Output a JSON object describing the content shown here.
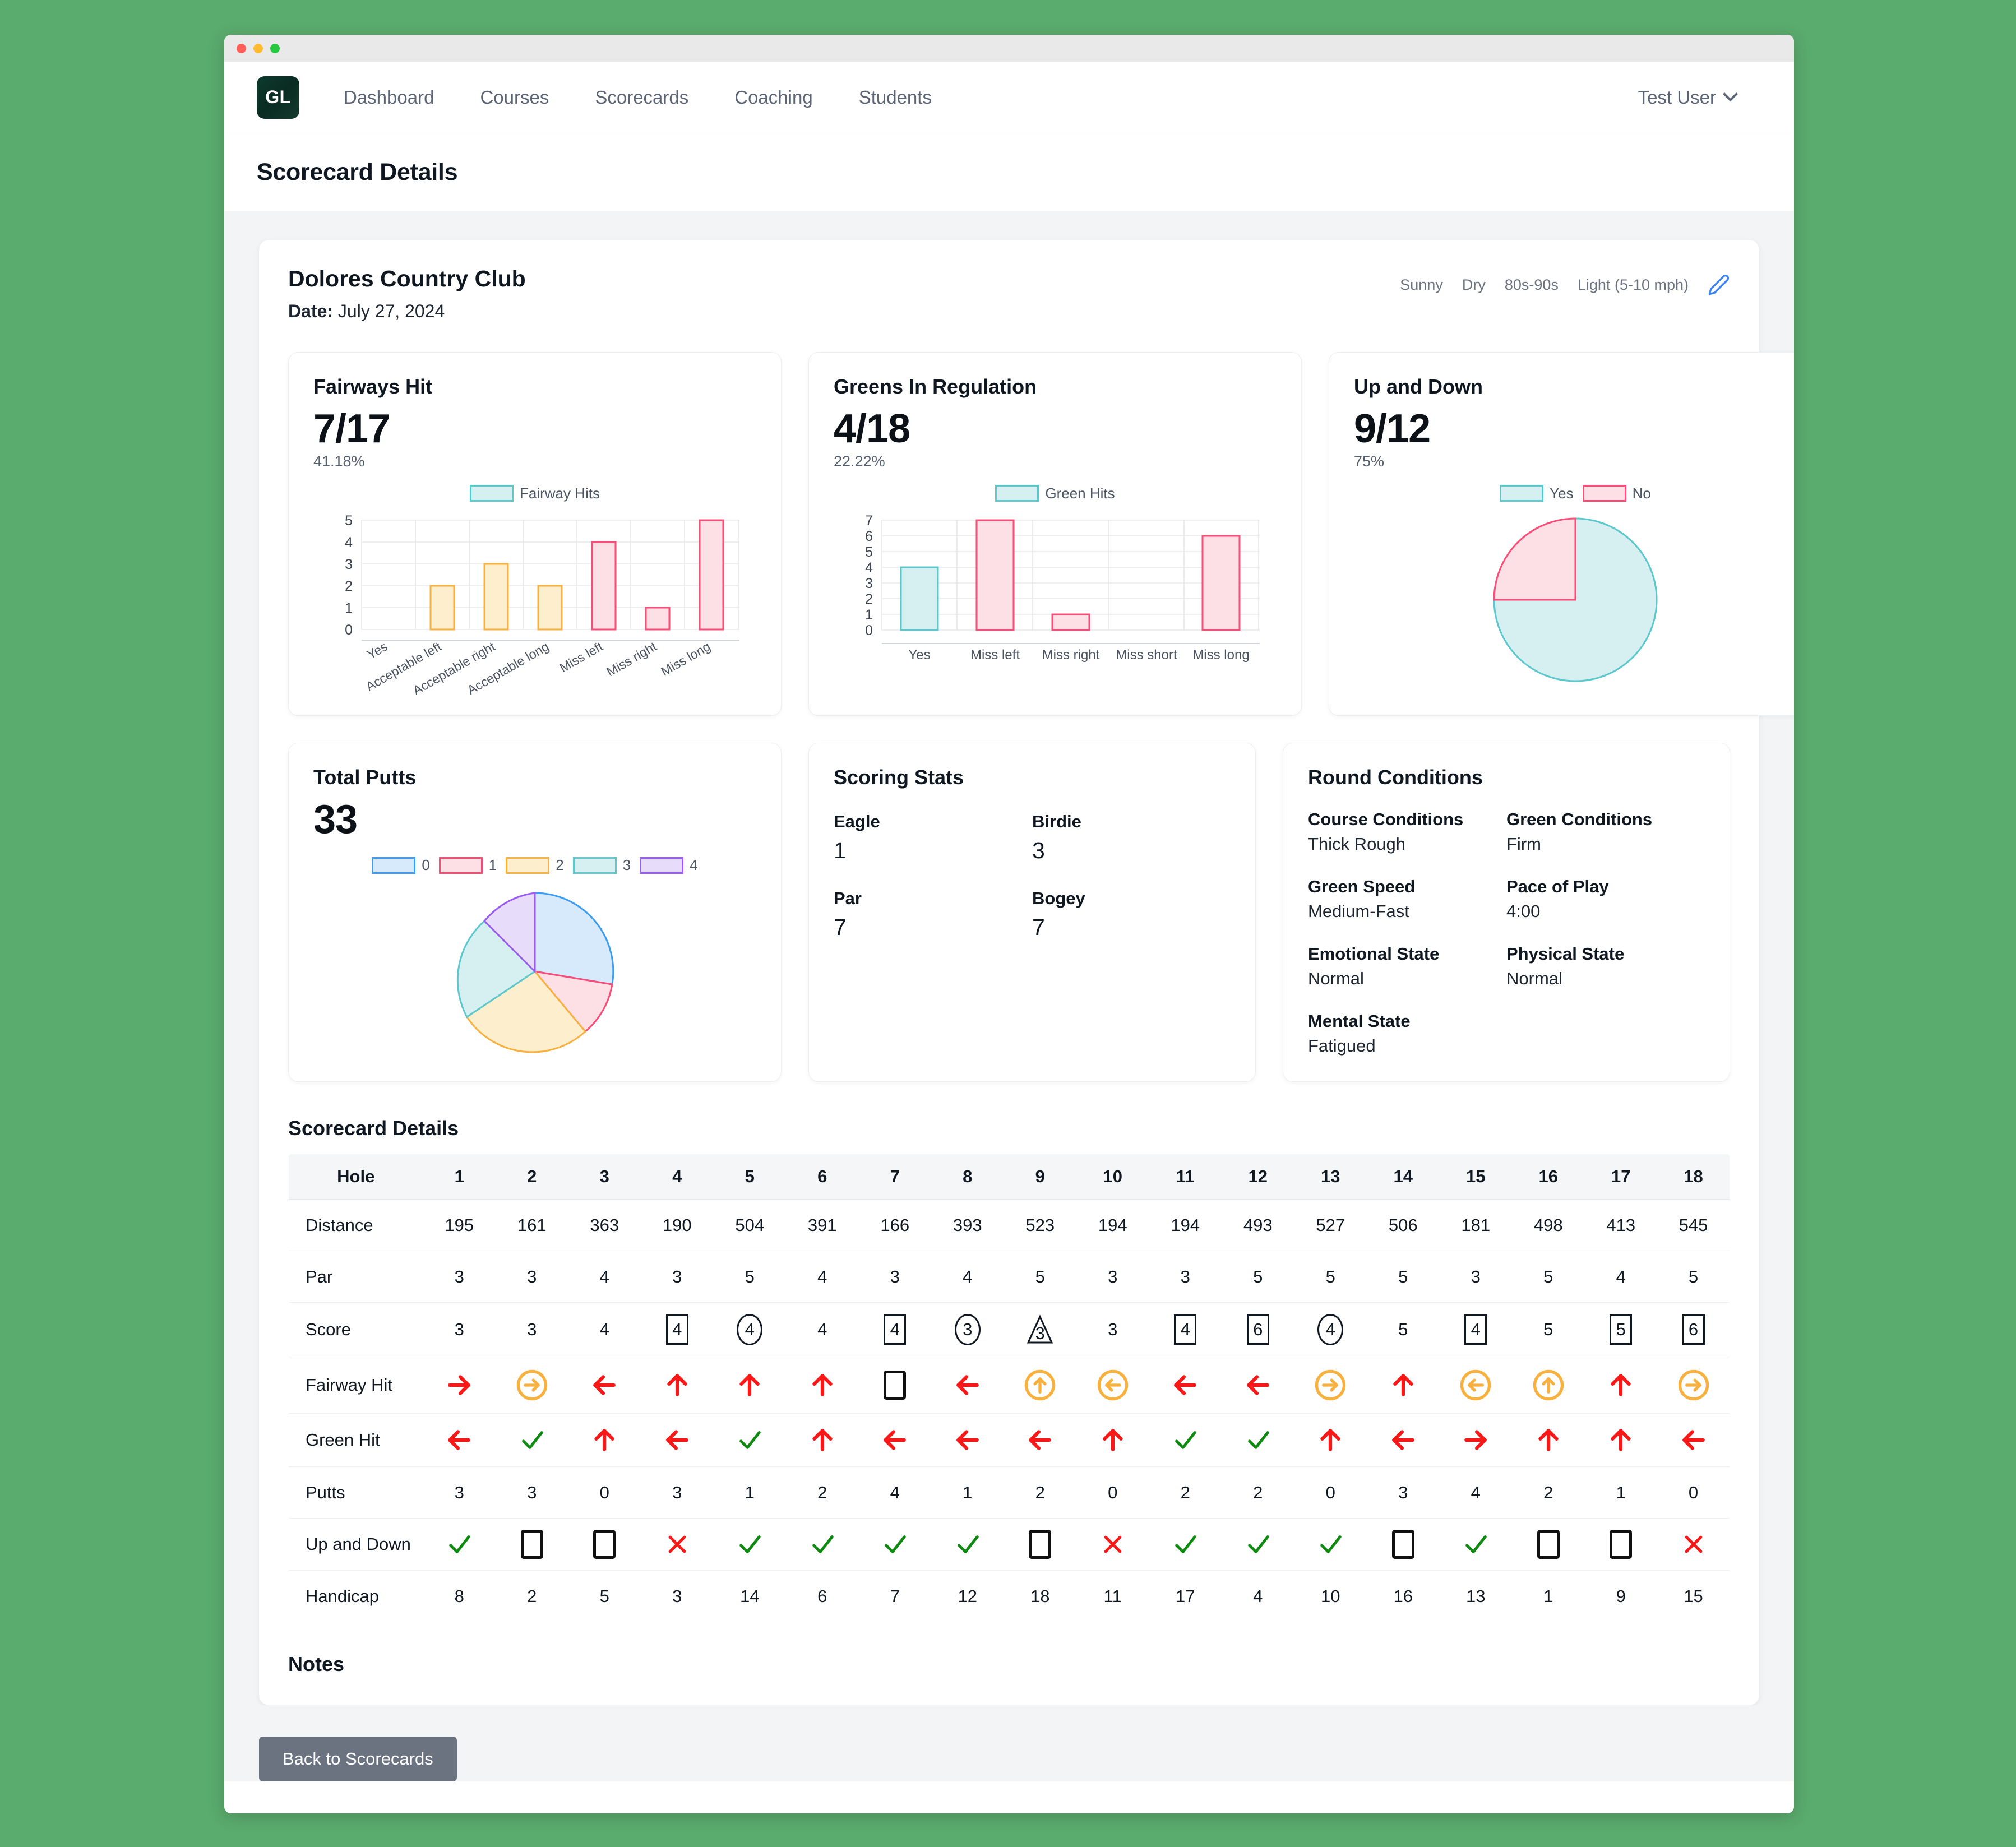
{
  "window": {
    "controls": [
      "close",
      "minimize",
      "maximize"
    ]
  },
  "nav": {
    "logo": "GL",
    "links": [
      "Dashboard",
      "Courses",
      "Scorecards",
      "Coaching",
      "Students"
    ],
    "user": "Test User"
  },
  "page": {
    "title": "Scorecard Details"
  },
  "course": {
    "name": "Dolores Country Club",
    "date_label": "Date:",
    "date_value": "July 27, 2024",
    "conditions_inline": [
      "Sunny",
      "Dry",
      "80s-90s",
      "Light (5-10 mph)"
    ],
    "edit_icon": "pencil-icon"
  },
  "cards": {
    "fairways": {
      "title": "Fairways Hit",
      "value": "7/17",
      "percent": "41.18%"
    },
    "gir": {
      "title": "Greens In Regulation",
      "value": "4/18",
      "percent": "22.22%"
    },
    "updown": {
      "title": "Up and Down",
      "value": "9/12",
      "percent": "75%"
    },
    "putts": {
      "title": "Total Putts",
      "value": "33"
    }
  },
  "scoring_stats": {
    "title": "Scoring Stats",
    "items": [
      {
        "label": "Eagle",
        "value": "1"
      },
      {
        "label": "Birdie",
        "value": "3"
      },
      {
        "label": "Par",
        "value": "7"
      },
      {
        "label": "Bogey",
        "value": "7"
      }
    ]
  },
  "round_conditions": {
    "title": "Round Conditions",
    "items": [
      {
        "label": "Course Conditions",
        "value": "Thick Rough"
      },
      {
        "label": "Green Conditions",
        "value": "Firm"
      },
      {
        "label": "Green Speed",
        "value": "Medium-Fast"
      },
      {
        "label": "Pace of Play",
        "value": "4:00"
      },
      {
        "label": "Emotional State",
        "value": "Normal"
      },
      {
        "label": "Physical State",
        "value": "Normal"
      },
      {
        "label": "Mental State",
        "value": "Fatigued"
      }
    ]
  },
  "scorecard": {
    "title": "Scorecard Details",
    "row_labels": [
      "Hole",
      "Distance",
      "Par",
      "Score",
      "Fairway Hit",
      "Green Hit",
      "Putts",
      "Up and Down",
      "Handicap"
    ],
    "holes": [
      1,
      2,
      3,
      4,
      5,
      6,
      7,
      8,
      9,
      10,
      11,
      12,
      13,
      14,
      15,
      16,
      17,
      18
    ],
    "distance": [
      195,
      161,
      363,
      190,
      504,
      391,
      166,
      393,
      523,
      194,
      194,
      493,
      527,
      506,
      181,
      498,
      413,
      545
    ],
    "par": [
      3,
      3,
      4,
      3,
      5,
      4,
      3,
      4,
      5,
      3,
      3,
      5,
      5,
      5,
      3,
      5,
      4,
      5
    ],
    "score": [
      {
        "v": "3",
        "shape": "none"
      },
      {
        "v": "3",
        "shape": "none"
      },
      {
        "v": "4",
        "shape": "none"
      },
      {
        "v": "4",
        "shape": "square"
      },
      {
        "v": "4",
        "shape": "circle"
      },
      {
        "v": "4",
        "shape": "none"
      },
      {
        "v": "4",
        "shape": "square"
      },
      {
        "v": "3",
        "shape": "circle"
      },
      {
        "v": "3",
        "shape": "triangle"
      },
      {
        "v": "3",
        "shape": "none"
      },
      {
        "v": "4",
        "shape": "square"
      },
      {
        "v": "6",
        "shape": "square"
      },
      {
        "v": "4",
        "shape": "circle"
      },
      {
        "v": "5",
        "shape": "none"
      },
      {
        "v": "4",
        "shape": "square"
      },
      {
        "v": "5",
        "shape": "none"
      },
      {
        "v": "5",
        "shape": "square"
      },
      {
        "v": "6",
        "shape": "square"
      }
    ],
    "fairway_hit": [
      "arrow-right-red",
      "circle-arrow-right-orange",
      "arrow-left-red",
      "arrow-up-red",
      "arrow-up-red",
      "arrow-up-red",
      "box-black",
      "arrow-left-red",
      "circle-arrow-up-orange",
      "circle-arrow-left-orange",
      "arrow-left-red",
      "arrow-left-red",
      "circle-arrow-right-orange",
      "arrow-up-red",
      "circle-arrow-left-orange",
      "circle-arrow-up-orange",
      "arrow-up-red",
      "circle-arrow-right-orange"
    ],
    "green_hit": [
      "arrow-left-red",
      "check-green",
      "arrow-up-red",
      "arrow-left-red",
      "check-green",
      "arrow-up-red",
      "arrow-left-red",
      "arrow-left-red",
      "arrow-left-red",
      "arrow-up-red",
      "check-green",
      "check-green",
      "arrow-up-red",
      "arrow-left-red",
      "arrow-right-red",
      "arrow-up-red",
      "arrow-up-red",
      "arrow-left-red"
    ],
    "putts": [
      3,
      3,
      0,
      3,
      1,
      2,
      4,
      1,
      2,
      0,
      2,
      2,
      0,
      3,
      4,
      2,
      1,
      0
    ],
    "up_and_down": [
      "check-green",
      "box-black",
      "box-black",
      "x-red",
      "check-green",
      "check-green",
      "check-green",
      "check-green",
      "box-black",
      "x-red",
      "check-green",
      "check-green",
      "check-green",
      "box-black",
      "check-green",
      "box-black",
      "box-black",
      "x-red"
    ],
    "handicap": [
      8,
      2,
      5,
      3,
      14,
      6,
      7,
      12,
      18,
      11,
      17,
      4,
      10,
      16,
      13,
      1,
      9,
      15
    ]
  },
  "notes": {
    "title": "Notes"
  },
  "footer": {
    "back_button": "Back to Scorecards"
  },
  "colors": {
    "teal_fill": "#d6eff0",
    "teal_stroke": "#5cc8ce",
    "pink_fill": "#fddfe6",
    "pink_stroke": "#f94c76",
    "orange_fill": "#fdeecd",
    "orange_stroke": "#f8b13e",
    "blue_fill": "#d6eafc",
    "blue_stroke": "#3b9cf0",
    "purple_fill": "#e8dcfb",
    "purple_stroke": "#9a5cf5",
    "red": "#f91818",
    "green": "#0e8a10",
    "accent_blue": "#3b82f6"
  },
  "chart_data": [
    {
      "type": "bar",
      "title": "Fairways Hit",
      "legend": [
        "Fairway Hits"
      ],
      "legend_position": "top",
      "categories": [
        "Yes",
        "Acceptable left",
        "Acceptable right",
        "Acceptable long",
        "Miss left",
        "Miss right",
        "Miss long"
      ],
      "values": [
        0,
        2,
        3,
        2,
        4,
        1,
        5
      ],
      "bar_colors": [
        "teal",
        "orange",
        "orange",
        "orange",
        "pink",
        "pink",
        "pink"
      ],
      "ylim": [
        0,
        5
      ],
      "yticks": [
        0,
        1,
        2,
        3,
        4,
        5
      ],
      "xlabel": "",
      "ylabel": "",
      "grid": true
    },
    {
      "type": "bar",
      "title": "Greens In Regulation",
      "legend": [
        "Green Hits"
      ],
      "legend_position": "top",
      "categories": [
        "Yes",
        "Miss left",
        "Miss right",
        "Miss short",
        "Miss long"
      ],
      "values": [
        4,
        7,
        1,
        0,
        6
      ],
      "bar_colors": [
        "teal",
        "pink",
        "pink",
        "pink",
        "pink"
      ],
      "ylim": [
        0,
        7
      ],
      "yticks": [
        0,
        1,
        2,
        3,
        4,
        5,
        6,
        7
      ],
      "xlabel": "",
      "ylabel": "",
      "grid": true
    },
    {
      "type": "pie",
      "title": "Up and Down",
      "legend": [
        "Yes",
        "No"
      ],
      "legend_position": "top",
      "labels": [
        "Yes",
        "No"
      ],
      "values": [
        9,
        3
      ],
      "percentages": [
        75,
        25
      ],
      "slice_colors": [
        "teal",
        "pink"
      ]
    },
    {
      "type": "pie",
      "title": "Total Putts",
      "legend": [
        "0",
        "1",
        "2",
        "3",
        "4"
      ],
      "legend_position": "top",
      "labels": [
        "0",
        "1",
        "2",
        "3",
        "4"
      ],
      "values": [
        4,
        3,
        5,
        4,
        2
      ],
      "slice_colors": [
        "blue",
        "pink",
        "orange",
        "teal",
        "purple"
      ]
    }
  ]
}
